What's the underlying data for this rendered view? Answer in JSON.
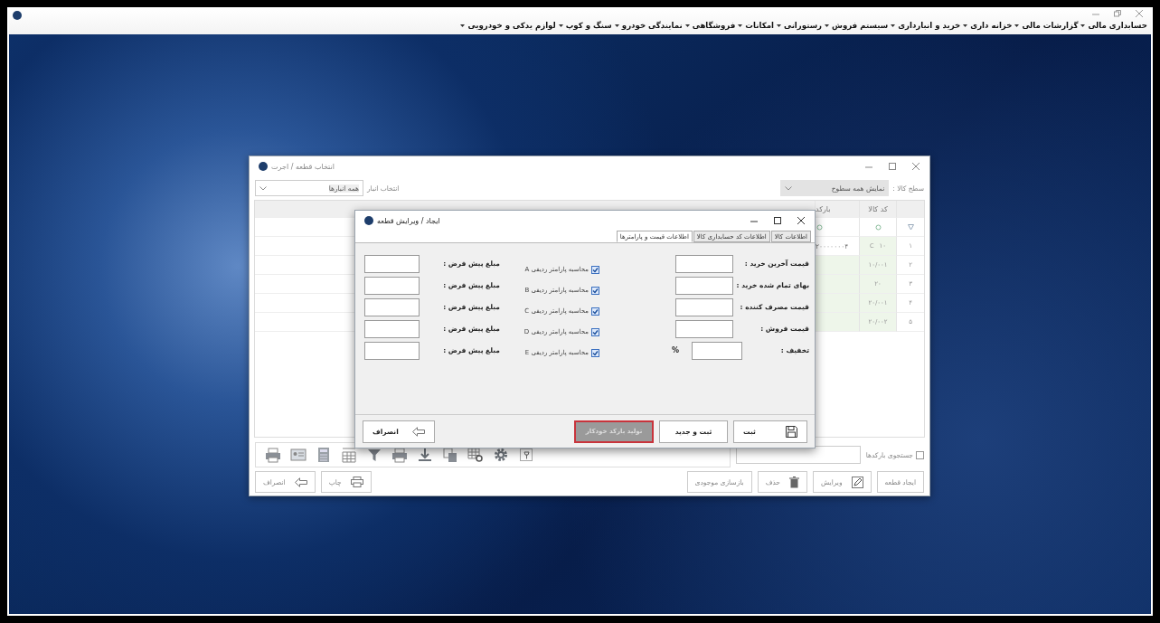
{
  "menu": [
    {
      "label": "حسابداری مالی"
    },
    {
      "label": "گزارشات مالی"
    },
    {
      "label": "خزانه داری"
    },
    {
      "label": "خرید و انبارداری"
    },
    {
      "label": "سیستم فروش"
    },
    {
      "label": "رستورانی"
    },
    {
      "label": "امکانات"
    },
    {
      "label": "فروشگاهی"
    },
    {
      "label": "نمایندگی خودرو"
    },
    {
      "label": "سنگ و کوپ"
    },
    {
      "label": "لوازم یدکی و خودرویی"
    }
  ],
  "picker_window": {
    "title": "انتخاب قطعه / اجرت",
    "level_label": "سطح کالا :",
    "level_value": "نمایش همه سطوح",
    "warehouse_label": "انتخاب انبار",
    "warehouse_value": "همه انبارها",
    "columns": [
      "کد کالا",
      "بارکد"
    ],
    "rows": [
      {
        "number": "۱",
        "code": "۱۰",
        "marker": "C",
        "barcode": "۲۰۰۰۰۰۰۰۴"
      },
      {
        "number": "۲",
        "code": "۱۰/۰۰۱"
      },
      {
        "number": "۳",
        "code": "۲۰"
      },
      {
        "number": "۴",
        "code": "۲۰/۰۰۱"
      },
      {
        "number": "۵",
        "code": "۲۰/۰۰۲"
      }
    ],
    "barcode_search": {
      "label": "جستجوی بارکدها",
      "checked": false
    },
    "buttons": [
      {
        "label": "ایجاد قطعه",
        "kind": "plain"
      },
      {
        "label": "ویرایش",
        "kind": "edit"
      },
      {
        "label": "حذف",
        "kind": "delete"
      },
      {
        "label": "بازسازی موجودی",
        "kind": "plain"
      },
      {
        "label": "چاپ",
        "kind": "print"
      },
      {
        "label": "انصراف",
        "kind": "cancel"
      }
    ]
  },
  "editor_dialog": {
    "title": "ایجاد / ویرایش قطعه",
    "tabs": [
      {
        "label": "اطلاعات کالا",
        "selected": false
      },
      {
        "label": "اطلاعات کد حسابداری کالا",
        "selected": false
      },
      {
        "label": "اطلاعات قیمت و پارامترها",
        "selected": true
      }
    ],
    "price_fields": [
      {
        "label": "قیمت آخرین خرید :"
      },
      {
        "label": "بهای تمام شده خرید :"
      },
      {
        "label": "قیمت مصرف کننده :"
      },
      {
        "label": "قیمت فروش :"
      },
      {
        "label": "تخفیف :",
        "suffix": "%"
      }
    ],
    "parameters": [
      {
        "label": "محاسبه پارامتر ردیفی A",
        "checked": true
      },
      {
        "label": "محاسبه پارامتر ردیفی B",
        "checked": true
      },
      {
        "label": "محاسبه پارامتر ردیفی C",
        "checked": true
      },
      {
        "label": "محاسبه پارامتر ردیفی D",
        "checked": true
      },
      {
        "label": "محاسبه پارامتر ردیفی E",
        "checked": true
      }
    ],
    "default_amounts": [
      {
        "label": "مبلغ پیش فرض :"
      },
      {
        "label": "مبلغ پیش فرض :"
      },
      {
        "label": "مبلغ پیش فرض :"
      },
      {
        "label": "مبلغ پیش فرض :"
      },
      {
        "label": "مبلغ پیش فرض :"
      }
    ],
    "buttons": [
      {
        "label": "ثبت",
        "kind": "save"
      },
      {
        "label": "ثبت و جدید",
        "kind": "plain"
      },
      {
        "label": "تولید بارکد خودکار",
        "kind": "highlighted"
      },
      {
        "label": "انصراف",
        "kind": "cancel"
      }
    ]
  }
}
